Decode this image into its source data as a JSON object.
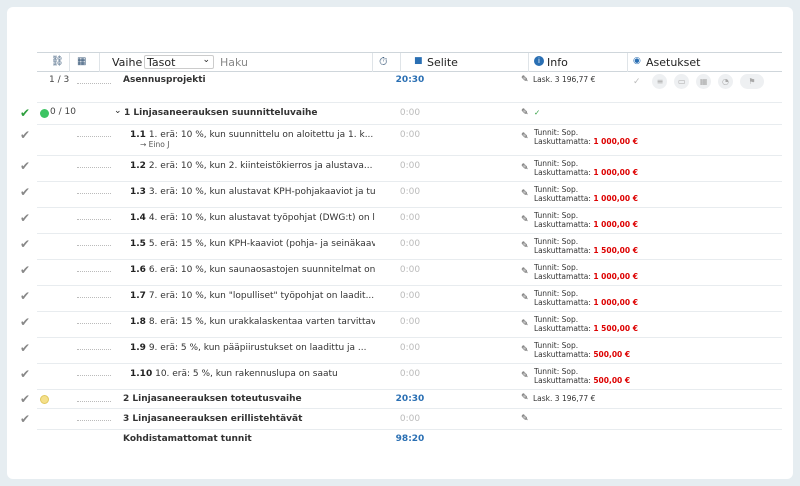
{
  "header": {
    "vaihe_label": "Vaihe",
    "select_value": "Tasot",
    "search_placeholder": "Haku",
    "selite_label": "Selite",
    "info_label": "Info",
    "asetukset_label": "Asetukset"
  },
  "project": {
    "count": "1 / 3",
    "name": "Asennusprojekti",
    "time": "20:30",
    "info": "Lask. 3 196,77 €"
  },
  "phase1": {
    "count": "0 / 10",
    "name": "1 Linjasaneerauksen suunnitteluvaihe",
    "time": "0:00",
    "info": "✓"
  },
  "tasks": [
    {
      "num": "1.1",
      "text": "1. erä: 10 %, kun suunnittelu on aloitettu ja 1. k...",
      "sub": "→ Eino J",
      "time": "0:00",
      "info1": "Tunnit: Sop.",
      "info2": "Laskuttamatta:",
      "amount": "1 000,00 €"
    },
    {
      "num": "1.2",
      "text": "2. erä: 10 %, kun 2. kiinteistökierros ja alustava...",
      "sub": "",
      "time": "0:00",
      "info1": "Tunnit: Sop.",
      "info2": "Laskuttamatta:",
      "amount": "1 000,00 €"
    },
    {
      "num": "1.3",
      "text": "3. erä: 10 %, kun alustavat KPH-pohjakaaviot ja tu...",
      "sub": "",
      "time": "0:00",
      "info1": "Tunnit: Sop.",
      "info2": "Laskuttamatta:",
      "amount": "1 000,00 €"
    },
    {
      "num": "1.4",
      "text": "4. erä: 10 %, kun alustavat työpohjat (DWG:t) on l...",
      "sub": "",
      "time": "0:00",
      "info1": "Tunnit: Sop.",
      "info2": "Laskuttamatta:",
      "amount": "1 000,00 €"
    },
    {
      "num": "1.5",
      "text": "5. erä: 15 %, kun KPH-kaaviot (pohja- ja seinäkaav...",
      "sub": "",
      "time": "0:00",
      "info1": "Tunnit: Sop.",
      "info2": "Laskuttamatta:",
      "amount": "1 500,00 €"
    },
    {
      "num": "1.6",
      "text": "6. erä: 10 %, kun saunaosastojen suunnitelmat on l...",
      "sub": "",
      "time": "0:00",
      "info1": "Tunnit: Sop.",
      "info2": "Laskuttamatta:",
      "amount": "1 000,00 €"
    },
    {
      "num": "1.7",
      "text": "7. erä: 10 %, kun \"lopulliset\" työpohjat on laadit...",
      "sub": "",
      "time": "0:00",
      "info1": "Tunnit: Sop.",
      "info2": "Laskuttamatta:",
      "amount": "1 000,00 €"
    },
    {
      "num": "1.8",
      "text": "8. erä: 15 %, kun urakkalaskentaa varten tarvittav...",
      "sub": "",
      "time": "0:00",
      "info1": "Tunnit: Sop.",
      "info2": "Laskuttamatta:",
      "amount": "1 500,00 €"
    },
    {
      "num": "1.9",
      "text": "9. erä: 5 %, kun pääpiirustukset on laadittu ja ...",
      "sub": "",
      "time": "0:00",
      "info1": "Tunnit: Sop.",
      "info2": "Laskuttamatta:",
      "amount": "500,00 €"
    },
    {
      "num": "1.10",
      "text": "10. erä: 5 %, kun rakennuslupa on saatu",
      "sub": "",
      "time": "0:00",
      "info1": "Tunnit: Sop.",
      "info2": "Laskuttamatta:",
      "amount": "500,00 €"
    }
  ],
  "phase2": {
    "name": "2 Linjasaneerauksen toteutusvaihe",
    "time": "20:30",
    "info": "Lask. 3 196,77 €"
  },
  "phase3": {
    "name": "3 Linjasaneerauksen erillistehtävät",
    "time": "0:00"
  },
  "footer": {
    "label": "Kohdistamattomat tunnit",
    "time": "98:20"
  },
  "colors": {
    "green": "#2e9e3e",
    "red": "#d00000",
    "blue": "#2a6fb3",
    "yellow": "#f5e08a"
  }
}
